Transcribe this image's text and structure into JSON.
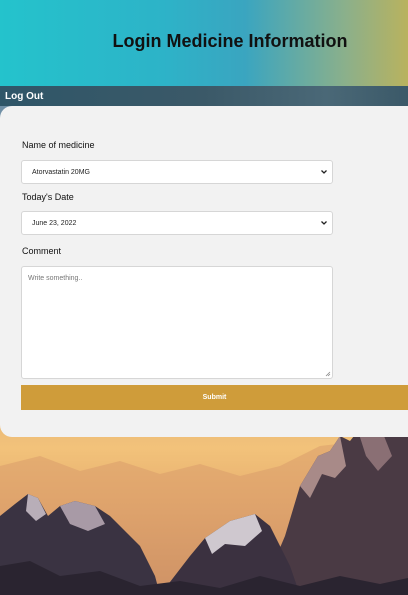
{
  "header": {
    "title": "Login Medicine Information"
  },
  "nav": {
    "logout_label": "Log Out"
  },
  "form": {
    "medicine_label": "Name of medicine",
    "medicine_value": "Atorvastatin 20MG",
    "date_label": "Today's Date",
    "date_value": "June 23, 2022",
    "comment_label": "Comment",
    "comment_placeholder": "Write something..",
    "submit_label": "Submit"
  },
  "colors": {
    "accent": "#cf9c3a",
    "nav": "#3b5968"
  }
}
